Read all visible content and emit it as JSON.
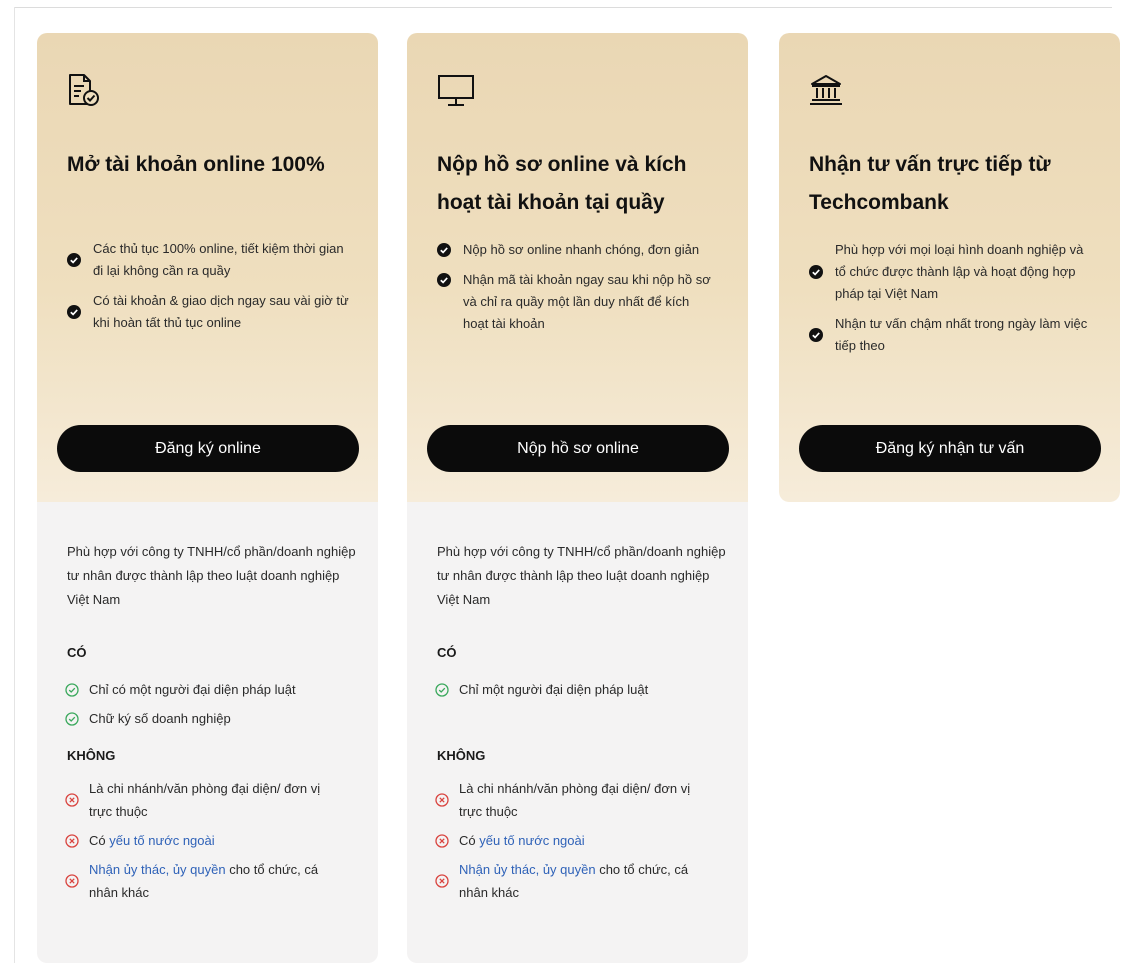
{
  "cards": [
    {
      "icon": "document-check-icon",
      "title": "Mở tài khoản online 100%",
      "features": [
        "Các thủ tục 100% online, tiết kiệm thời gian đi lại không cần ra quầy",
        "Có tài khoản & giao dịch ngay sau vài giờ từ khi hoàn tất thủ tục online"
      ],
      "button": "Đăng ký online",
      "description": "Phù hợp với công ty TNHH/cổ phần/doanh nghiệp tư nhân được thành lập theo luật doanh nghiệp Việt Nam",
      "yes_title": "CÓ",
      "yes_items": [
        {
          "text": "Chỉ có một người đại diện pháp luật"
        },
        {
          "link": "Chữ ký số doanh nghiệp"
        }
      ],
      "no_title": "KHÔNG",
      "no_items": [
        {
          "text": "Là chi nhánh/văn phòng đại diện/ đơn vị trực thuộc"
        },
        {
          "pre": "Có ",
          "link": "yếu tố nước ngoài"
        },
        {
          "link": "Nhận ủy thác, ủy quyền",
          "post": " cho tổ chức, cá nhân khác"
        }
      ]
    },
    {
      "icon": "monitor-icon",
      "title": "Nộp hồ sơ online và kích hoạt tài khoản tại quầy",
      "features": [
        "Nộp hồ sơ online nhanh chóng, đơn giản",
        "Nhận mã tài khoản ngay sau khi nộp hồ sơ và chỉ ra quầy một lần duy nhất để kích hoạt tài khoản"
      ],
      "button": "Nộp hồ sơ online",
      "description": "Phù hợp với công ty TNHH/cổ phần/doanh nghiệp tư nhân được thành lập theo luật doanh nghiệp Việt Nam",
      "yes_title": "CÓ",
      "yes_items": [
        {
          "text": "Chỉ một người đại diện pháp luật"
        }
      ],
      "no_title": "KHÔNG",
      "no_items": [
        {
          "text": "Là chi nhánh/văn phòng đại diện/ đơn vị trực thuộc"
        },
        {
          "pre": "Có ",
          "link": "yếu tố nước ngoài"
        },
        {
          "link": "Nhận ủy thác, ủy quyền",
          "post": " cho tổ chức, cá nhân khác"
        }
      ]
    },
    {
      "icon": "bank-icon",
      "title": "Nhận tư vấn trực tiếp từ Techcombank",
      "features": [
        "Phù hợp với mọi loại hình doanh nghiệp và tổ chức được thành lập và hoạt động hợp pháp tại Việt Nam",
        "Nhận tư vấn chậm nhất trong ngày làm việc tiếp theo"
      ],
      "button": "Đăng ký nhận tư vấn"
    }
  ],
  "colors": {
    "card_gold": "#ead7b4",
    "card_gray": "#f4f3f3",
    "button": "#0b0b0b",
    "link": "#2f62b8",
    "yes": "#3aa85c",
    "no": "#d9443f"
  }
}
